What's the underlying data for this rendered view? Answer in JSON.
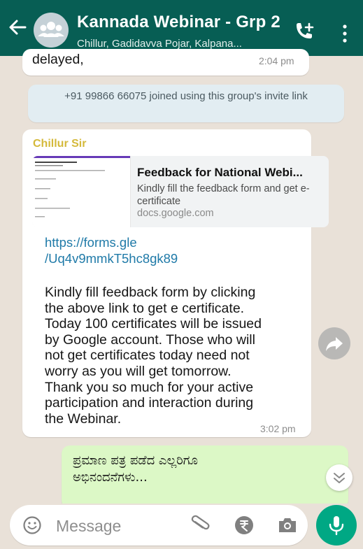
{
  "header": {
    "title": "Kannada Webinar - Grp 2",
    "subtitle": "Chillur, Gadidavva Pojar, Kalpana..."
  },
  "messages": {
    "partial": {
      "text": "delayed,",
      "time": "2:04 pm"
    },
    "system": {
      "text": "+91 99866 66075 joined using this group's invite link"
    },
    "incoming": {
      "sender": "Chillur Sir",
      "link_preview": {
        "title": "Feedback for National Webi...",
        "description": "Kindly fill the feedback form and get e-certificate",
        "domain": "docs.google.com"
      },
      "url_line1": "https://forms.gle",
      "url_line2": "/Uq4v9mmkT5hc8gk89",
      "lines": [
        "Kindly fill feedback form by clicking",
        "the above link to get e certificate.",
        "Today 100 certificates will be issued",
        "by Google account. Those who will",
        "not get certificates today need not",
        "worry as you will get tomorrow.",
        "Thank you so much for your active",
        "participation and interaction during",
        "the Webinar."
      ],
      "time": "3:02 pm"
    },
    "outgoing": {
      "line1": "ಪ್ರಮಾಣ ಪತ್ರ ಪಡೆದ ಎಲ್ಲರಿಗೂ",
      "line2": "ಅಭಿನಂದನೆಗಳು..."
    }
  },
  "input": {
    "placeholder": "Message"
  },
  "colors": {
    "header": "#075e54",
    "sender_name": "#d4b93a",
    "link": "#1f7aa8",
    "outgoing_bubble": "#dcf8c6",
    "mic_button": "#00a884"
  }
}
